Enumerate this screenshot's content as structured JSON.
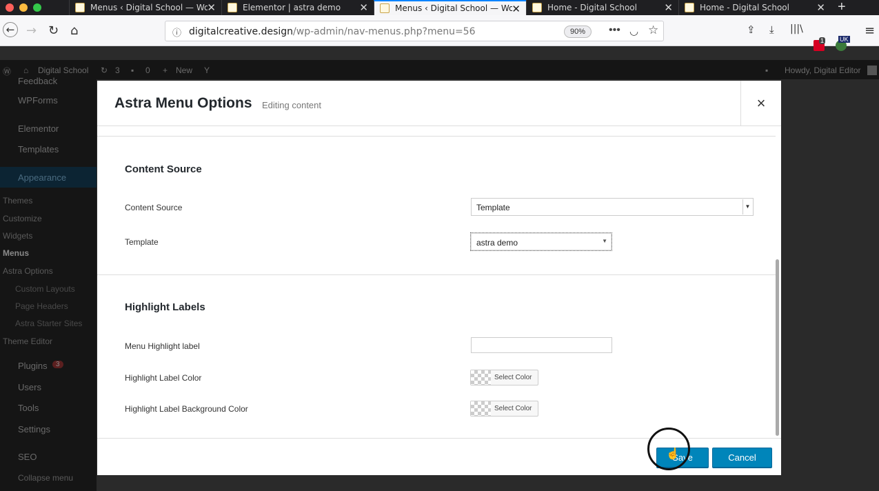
{
  "browser": {
    "tabs": [
      {
        "title": "Menus ‹ Digital School — Word"
      },
      {
        "title": "Elementor | astra demo"
      },
      {
        "title": "Menus ‹ Digital School — Word"
      },
      {
        "title": "Home - Digital School"
      },
      {
        "title": "Home - Digital School"
      }
    ],
    "url_host": "digitalcreative.design",
    "url_path": "/wp-admin/nav-menus.php?menu=56",
    "zoom": "90%",
    "notification_badge": "1",
    "locale_badge": "UK"
  },
  "adminbar": {
    "site": "Digital School",
    "updates": "3",
    "comments": "0",
    "new": "New",
    "howdy": "Howdy, Digital Editor"
  },
  "sidebar": {
    "feedback": "Feedback",
    "wpforms": "WPForms",
    "elementor": "Elementor",
    "templates": "Templates",
    "appearance": "Appearance",
    "themes": "Themes",
    "customize": "Customize",
    "widgets": "Widgets",
    "menus": "Menus",
    "astra_options": "Astra Options",
    "custom_layouts": "Custom Layouts",
    "page_headers": "Page Headers",
    "astra_starter_sites": "Astra Starter Sites",
    "theme_editor": "Theme Editor",
    "plugins": "Plugins",
    "plugins_count": "3",
    "users": "Users",
    "tools": "Tools",
    "settings": "Settings",
    "seo": "SEO",
    "collapse": "Collapse menu"
  },
  "modal": {
    "title": "Astra Menu Options",
    "subtitle": "Editing content",
    "close": "×",
    "content_section": {
      "heading": "Content Source",
      "source_label": "Content Source",
      "source_value": "Template",
      "template_label": "Template",
      "template_value": "astra demo"
    },
    "highlight_section": {
      "heading": "Highlight Labels",
      "label_label": "Menu Highlight label",
      "label_value": "",
      "color_label": "Highlight Label Color",
      "bg_color_label": "Highlight Label Background Color",
      "select_color": "Select Color"
    },
    "save": "Save",
    "cancel": "Cancel"
  }
}
